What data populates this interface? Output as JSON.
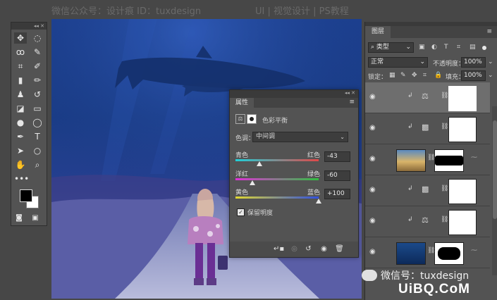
{
  "watermark_top": {
    "account": "微信公众号：设计痕  ID：tuxdesign",
    "site": "UI | 视觉设计 | PS教程"
  },
  "toolbar": {
    "tools": [
      {
        "name": "move-tool-icon",
        "glyph": "✥"
      },
      {
        "name": "marquee-tool-icon",
        "glyph": "◌"
      },
      {
        "name": "lasso-tool-icon",
        "glyph": "ꝏ"
      },
      {
        "name": "quick-select-tool-icon",
        "glyph": "✎"
      },
      {
        "name": "crop-tool-icon",
        "glyph": "⌗"
      },
      {
        "name": "eyedropper-tool-icon",
        "glyph": "✐"
      },
      {
        "name": "healing-brush-tool-icon",
        "glyph": "▮"
      },
      {
        "name": "brush-tool-icon",
        "glyph": "✏"
      },
      {
        "name": "clone-stamp-tool-icon",
        "glyph": "♟"
      },
      {
        "name": "history-brush-tool-icon",
        "glyph": "↺"
      },
      {
        "name": "eraser-tool-icon",
        "glyph": "◪"
      },
      {
        "name": "gradient-tool-icon",
        "glyph": "▭"
      },
      {
        "name": "blur-tool-icon",
        "glyph": "●"
      },
      {
        "name": "dodge-tool-icon",
        "glyph": "◯"
      },
      {
        "name": "pen-tool-icon",
        "glyph": "✒"
      },
      {
        "name": "type-tool-icon",
        "glyph": "T"
      },
      {
        "name": "path-select-tool-icon",
        "glyph": "➤"
      },
      {
        "name": "ellipse-tool-icon",
        "glyph": "○"
      },
      {
        "name": "hand-tool-icon",
        "glyph": "✋"
      },
      {
        "name": "zoom-tool-icon",
        "glyph": "⌕"
      },
      {
        "name": "more-tools-icon",
        "glyph": "•••"
      }
    ]
  },
  "properties": {
    "tab": "属性",
    "adjustment_name": "色彩平衡",
    "tone_label": "色调：",
    "tone_value": "中间调",
    "sliders": [
      {
        "left": "青色",
        "right": "红色",
        "value": "-43",
        "fraction": 0.285
      },
      {
        "left": "洋红",
        "right": "绿色",
        "value": "-60",
        "fraction": 0.2
      },
      {
        "left": "黄色",
        "right": "蓝色",
        "value": "+100",
        "fraction": 1.0
      }
    ],
    "preserve_luminosity": "保留明度"
  },
  "layers": {
    "tab": "图层",
    "filter_label": "类型",
    "blend_mode": "正常",
    "opacity_label": "不透明度：",
    "opacity_value": "100%",
    "lock_label": "锁定：",
    "fill_label": "填充：",
    "fill_value": "100%"
  },
  "watermark_bottom": {
    "wechat": "微信号：tuxdesign",
    "site": "UiBQ.CoM"
  }
}
